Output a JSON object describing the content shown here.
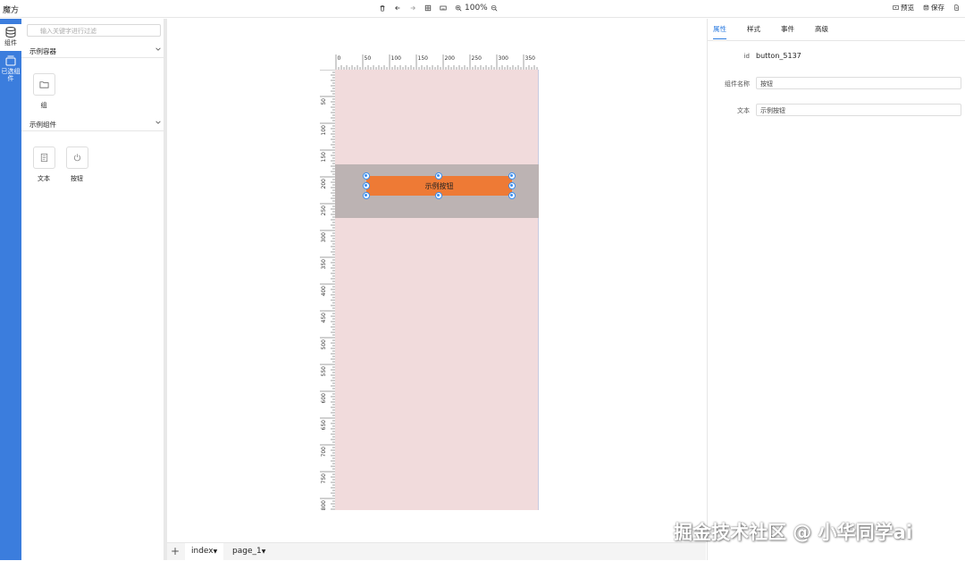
{
  "app": {
    "title": "魔方"
  },
  "toolbar": {
    "zoom": "100%",
    "icons": [
      "delete-icon",
      "undo-icon",
      "redo-icon",
      "grid-icon",
      "keyboard-icon",
      "zoom-in-icon",
      "zoom-out-icon"
    ]
  },
  "header_actions": {
    "preview_label": "预览",
    "save_label": "保存"
  },
  "left_nav": {
    "components_label": "组件",
    "selected_label": "已选组件",
    "colors": {
      "nav_bg": "#3b7ddd"
    }
  },
  "left_panel": {
    "search_placeholder": "输入关键字进行过滤",
    "sections": [
      {
        "title": "示例容器",
        "items": [
          {
            "label": "组",
            "icon": "folder-icon"
          }
        ]
      },
      {
        "title": "示例组件",
        "items": [
          {
            "label": "文本",
            "icon": "text-doc-icon"
          },
          {
            "label": "按钮",
            "icon": "power-icon"
          }
        ]
      }
    ]
  },
  "canvas": {
    "ruler_top_labels": [
      "0",
      "50",
      "100",
      "150",
      "200",
      "250",
      "300",
      "350"
    ],
    "ruler_left_labels": [
      "50",
      "100",
      "150",
      "200",
      "250",
      "300",
      "350",
      "400",
      "450",
      "500",
      "550",
      "600",
      "650",
      "700",
      "750",
      "800"
    ],
    "selected_button_text": "示例按钮",
    "colors": {
      "page_bg": "#f1dbdc",
      "container_bg": "#bcb3b3",
      "button_bg": "#ee7a35",
      "handle": "#3b8ff0"
    }
  },
  "bottom_bar": {
    "add_label": "+",
    "tabs": [
      {
        "label": "index",
        "active": true
      },
      {
        "label": "page_1",
        "active": false
      }
    ]
  },
  "right_panel": {
    "tabs": [
      "属性",
      "样式",
      "事件",
      "高级"
    ],
    "active_tab": "属性",
    "props": {
      "id_label": "id",
      "id_value": "button_5137",
      "name_label": "组件名称",
      "name_value": "按钮",
      "text_label": "文本",
      "text_value": "示例按钮"
    },
    "colors": {
      "accent": "#2e7de1"
    }
  },
  "watermark": "掘金技术社区 @ 小华同学ai"
}
